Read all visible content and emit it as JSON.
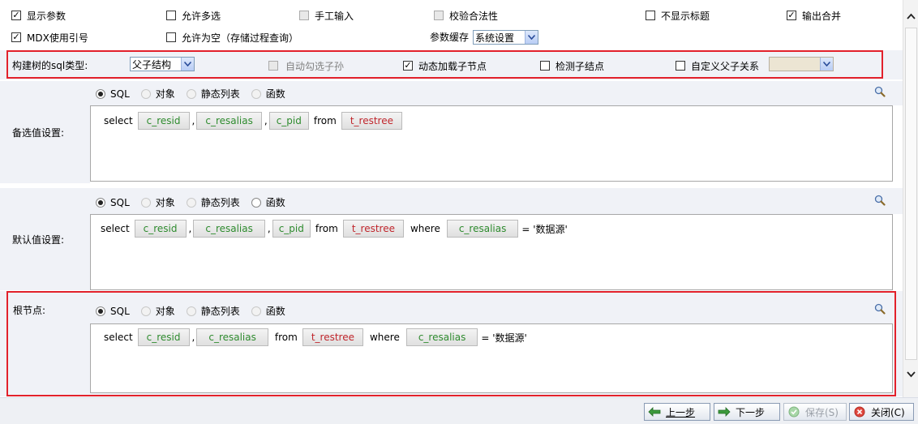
{
  "options_row1": {
    "show_params": {
      "label": "显示参数",
      "checked": true
    },
    "allow_multi": {
      "label": "允许多选",
      "checked": false
    },
    "manual_input": {
      "label": "手工输入",
      "checked": false,
      "disabled": true
    },
    "validate": {
      "label": "校验合法性",
      "checked": false,
      "disabled": true
    },
    "hide_title": {
      "label": "不显示标题",
      "checked": false
    },
    "merge_output": {
      "label": "输出合并",
      "checked": true
    }
  },
  "options_row2": {
    "mdx_quotes": {
      "label": "MDX使用引号",
      "checked": true
    },
    "allow_empty": {
      "label": "允许为空（存储过程查询）",
      "checked": false
    },
    "cache_label": "参数缓存",
    "cache_value": "系统设置"
  },
  "tree_row": {
    "label": "构建树的sql类型:",
    "type_value": "父子结构",
    "auto_check_children": {
      "label": "自动勾选子孙",
      "checked": false,
      "disabled": true
    },
    "dynamic_load": {
      "label": "动态加载子节点",
      "checked": true
    },
    "check_children": {
      "label": "检测子结点",
      "checked": false
    },
    "custom_relation": {
      "label": "自定义父子关系",
      "checked": false
    },
    "custom_value": ""
  },
  "radio_labels": {
    "sql": "SQL",
    "object": "对象",
    "static_list": "静态列表",
    "function": "函数"
  },
  "candidate": {
    "label": "备选值设置:",
    "select_kw": "select",
    "fields": [
      "c_resid",
      "c_resalias",
      "c_pid"
    ],
    "from_kw": "from",
    "table": "t_restree"
  },
  "default": {
    "label": "默认值设置:",
    "select_kw": "select",
    "fields": [
      "c_resid",
      "c_resalias",
      "c_pid"
    ],
    "from_kw": "from",
    "table": "t_restree",
    "where_kw": "where",
    "where_field": "c_resalias",
    "where_value": "= '数据源'"
  },
  "root": {
    "label": "根节点:",
    "select_kw": "select",
    "fields": [
      "c_resid",
      "c_resalias"
    ],
    "from_kw": "from",
    "table": "t_restree",
    "where_kw": "where",
    "where_field": "c_resalias",
    "where_value": "= '数据源'"
  },
  "footer": {
    "prev": "上一步",
    "next": "下一步",
    "save": "保存(S)",
    "close": "关闭(C)"
  },
  "colors": {
    "highlight": "#e2212b",
    "field": "#2e8b2e",
    "table": "#c0262c"
  }
}
